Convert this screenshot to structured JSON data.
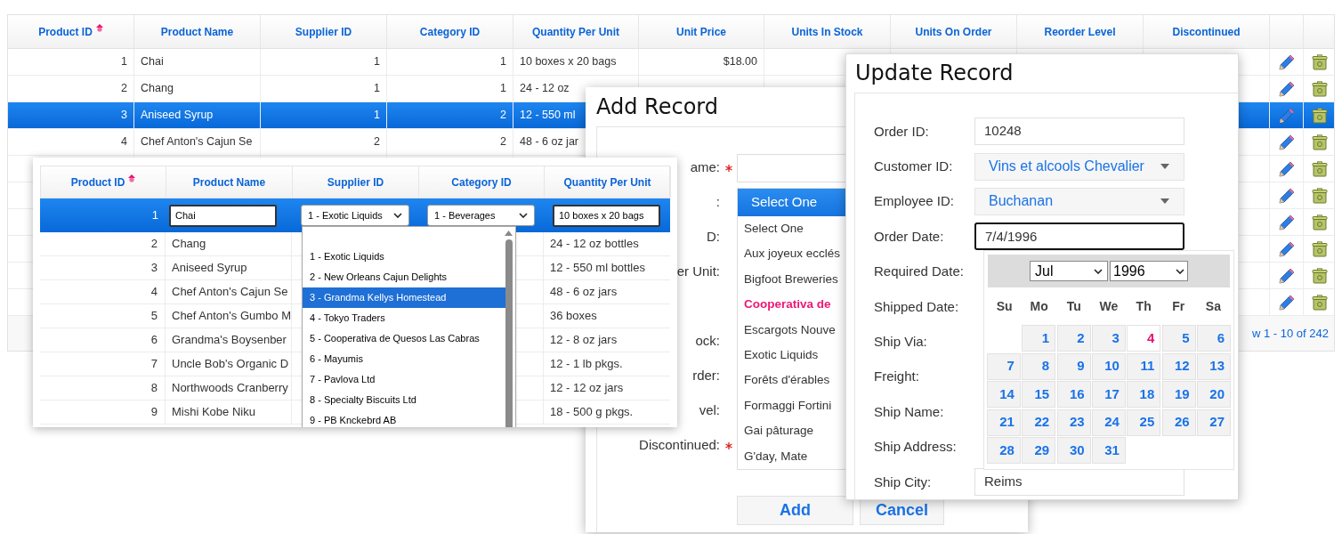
{
  "product_grid": {
    "columns": [
      {
        "label": "Product ID",
        "sorted": true
      },
      {
        "label": "Product Name",
        "sorted": false
      },
      {
        "label": "Supplier ID",
        "sorted": false
      },
      {
        "label": "Category ID",
        "sorted": false
      },
      {
        "label": "Quantity Per Unit",
        "sorted": false
      },
      {
        "label": "Unit Price",
        "sorted": false
      },
      {
        "label": "Units In Stock",
        "sorted": false
      },
      {
        "label": "Units On Order",
        "sorted": false
      },
      {
        "label": "Reorder Level",
        "sorted": false
      },
      {
        "label": "Discontinued",
        "sorted": false
      }
    ],
    "rows": [
      {
        "id": "1",
        "product_name": "Chai",
        "supplier_id": "1",
        "category_id": "1",
        "quantity_per_unit": "10 boxes x 20 bags",
        "unit_price": "$18.00",
        "selected": false
      },
      {
        "id": "2",
        "product_name": "Chang",
        "supplier_id": "1",
        "category_id": "1",
        "quantity_per_unit": "24 - 12 oz",
        "selected": false
      },
      {
        "id": "3",
        "product_name": "Aniseed Syrup",
        "supplier_id": "1",
        "category_id": "2",
        "quantity_per_unit": "12 - 550 ml",
        "selected": true
      },
      {
        "id": "4",
        "product_name": "Chef Anton's Cajun Se",
        "supplier_id": "2",
        "category_id": "2",
        "quantity_per_unit": "48 - 6 oz jar",
        "selected": false
      },
      {
        "selected": false
      },
      {
        "selected": false
      },
      {
        "selected": false
      },
      {
        "selected": false
      },
      {
        "selected": false
      },
      {
        "selected": false
      }
    ],
    "pager": {
      "summary": "w 1 - 10 of 242"
    }
  },
  "inline_edit_grid": {
    "columns": [
      {
        "label": "Product ID",
        "sorted": true
      },
      {
        "label": "Product Name",
        "sorted": false
      },
      {
        "label": "Supplier ID",
        "sorted": false
      },
      {
        "label": "Category ID",
        "sorted": false
      },
      {
        "label": "Quantity Per Unit",
        "sorted": false
      }
    ],
    "edit_row": {
      "id": "1",
      "product_name": "Chai",
      "supplier": "1 - Exotic Liquids",
      "category": "1 - Beverages",
      "quantity_per_unit": "10 boxes x 20 bags"
    },
    "rows": [
      {
        "id": "2",
        "product_name": "Chang",
        "quantity_per_unit": "24 - 12 oz bottles"
      },
      {
        "id": "3",
        "product_name": "Aniseed Syrup",
        "quantity_per_unit": "12 - 550 ml bottles"
      },
      {
        "id": "4",
        "product_name": "Chef Anton's Cajun Se",
        "quantity_per_unit": "48 - 6 oz jars"
      },
      {
        "id": "5",
        "product_name": "Chef Anton's Gumbo M",
        "quantity_per_unit": "36 boxes"
      },
      {
        "id": "6",
        "product_name": "Grandma's Boysenber",
        "quantity_per_unit": "12 - 8 oz jars"
      },
      {
        "id": "7",
        "product_name": "Uncle Bob's Organic D",
        "quantity_per_unit": "12 - 1 lb pkgs."
      },
      {
        "id": "8",
        "product_name": "Northwoods Cranberry",
        "quantity_per_unit": "12 - 12 oz jars"
      },
      {
        "id": "9",
        "product_name": "Mishi Kobe Niku",
        "quantity_per_unit": "18 - 500 g pkgs."
      }
    ],
    "supplier_dropdown": {
      "options": [
        {
          "label": "1 - Exotic Liquids",
          "selected": false
        },
        {
          "label": "2 - New Orleans Cajun Delights",
          "selected": false
        },
        {
          "label": "3 - Grandma Kellys Homestead",
          "selected": true
        },
        {
          "label": "4 - Tokyo Traders",
          "selected": false
        },
        {
          "label": "5 - Cooperativa de Quesos Las Cabras",
          "selected": false
        },
        {
          "label": "6 - Mayumis",
          "selected": false
        },
        {
          "label": "7 - Pavlova Ltd",
          "selected": false
        },
        {
          "label": "8 - Specialty Biscuits Ltd",
          "selected": false
        },
        {
          "label": "9 - PB Knckebrd AB",
          "selected": false
        }
      ]
    }
  },
  "add_record": {
    "title": "Add Record",
    "fields": [
      {
        "label": "ame:",
        "required": true,
        "has_input": true
      },
      {
        "label": ":",
        "required": false
      },
      {
        "label": "D:",
        "required": false
      },
      {
        "label": "er Unit:",
        "required": false
      },
      {
        "required": false
      },
      {
        "label": "ock:",
        "required": false
      },
      {
        "label": "rder:",
        "required": false
      },
      {
        "label": "vel:",
        "required": false
      },
      {
        "label": "Discontinued:",
        "required": true,
        "has_input": false
      }
    ],
    "listbox": {
      "header": "Select One",
      "options": [
        {
          "label": "Select One",
          "highlighted": false
        },
        {
          "label": "Aux joyeux ecclés",
          "highlighted": false
        },
        {
          "label": "Bigfoot Breweries",
          "highlighted": false
        },
        {
          "label": "Cooperativa de",
          "highlighted": true
        },
        {
          "label": "Escargots Nouve",
          "highlighted": false
        },
        {
          "label": "Exotic Liquids",
          "highlighted": false
        },
        {
          "label": "Forêts d'érables",
          "highlighted": false
        },
        {
          "label": "Formaggi Fortini",
          "highlighted": false
        },
        {
          "label": "Gai pâturage",
          "highlighted": false
        },
        {
          "label": "G'day, Mate",
          "highlighted": false
        }
      ]
    },
    "buttons": [
      {
        "label": "Add"
      },
      {
        "label": "Cancel"
      }
    ]
  },
  "update_record": {
    "title": "Update Record",
    "fields": [
      {
        "label": "Order ID:",
        "kind": "input",
        "value": "10248",
        "focused": false
      },
      {
        "label": "Customer ID:",
        "kind": "dropdown",
        "value": "Vins et alcools Chevalier",
        "focused": false
      },
      {
        "label": "Employee ID:",
        "kind": "dropdown",
        "value": "Buchanan",
        "focused": false
      },
      {
        "label": "Order Date:",
        "kind": "input",
        "value": "7/4/1996",
        "focused": true
      },
      {
        "label": "Required Date:"
      },
      {
        "label": "Shipped Date:"
      },
      {
        "label": "Ship Via:"
      },
      {
        "label": "Freight:"
      },
      {
        "label": "Ship Name:"
      },
      {
        "label": "Ship Address:"
      },
      {
        "label": "Ship City:",
        "kind": "input",
        "value": "Reims",
        "focused": false
      }
    ],
    "datepicker": {
      "month": "Jul",
      "year": "1996",
      "weekdays": [
        "Su",
        "Mo",
        "Tu",
        "We",
        "Th",
        "Fr",
        "Sa"
      ],
      "weeks": [
        [
          {
            "label": "1",
            "selected": false
          },
          {
            "label": "2",
            "selected": false
          },
          {
            "label": "3",
            "selected": false
          },
          {
            "label": "4",
            "selected": true
          },
          {
            "label": "5",
            "selected": false
          },
          {
            "label": "6",
            "selected": false
          }
        ],
        [
          {
            "label": "7",
            "selected": false
          },
          {
            "label": "8",
            "selected": false
          },
          {
            "label": "9",
            "selected": false
          },
          {
            "label": "10",
            "selected": false
          },
          {
            "label": "11",
            "selected": false
          },
          {
            "label": "12",
            "selected": false
          },
          {
            "label": "13",
            "selected": false
          }
        ],
        [
          {
            "label": "14",
            "selected": false
          },
          {
            "label": "15",
            "selected": false
          },
          {
            "label": "16",
            "selected": false
          },
          {
            "label": "17",
            "selected": false
          },
          {
            "label": "18",
            "selected": false
          },
          {
            "label": "19",
            "selected": false
          },
          {
            "label": "20",
            "selected": false
          }
        ],
        [
          {
            "label": "21",
            "selected": false
          },
          {
            "label": "22",
            "selected": false
          },
          {
            "label": "23",
            "selected": false
          },
          {
            "label": "24",
            "selected": false
          },
          {
            "label": "25",
            "selected": false
          },
          {
            "label": "26",
            "selected": false
          },
          {
            "label": "27",
            "selected": false
          }
        ],
        [
          {
            "label": "28",
            "selected": false
          },
          {
            "label": "29",
            "selected": false
          },
          {
            "label": "30",
            "selected": false
          },
          {
            "label": "31",
            "selected": false
          }
        ]
      ]
    }
  }
}
